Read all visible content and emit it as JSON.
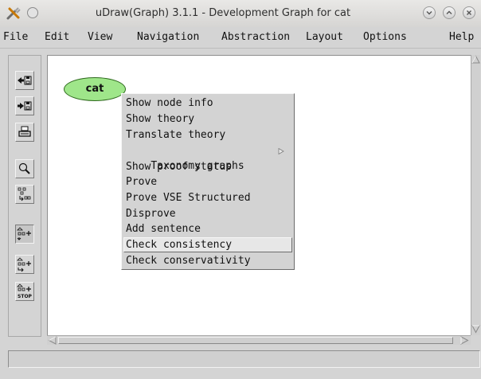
{
  "window": {
    "title": "uDraw(Graph) 3.1.1 - Development Graph for cat",
    "buttons": [
      "shade",
      "minimize",
      "maximize",
      "close"
    ]
  },
  "menubar": {
    "items": [
      {
        "label": "File"
      },
      {
        "label": "Edit"
      },
      {
        "label": "View"
      },
      {
        "label": "Navigation"
      },
      {
        "label": "Abstraction"
      },
      {
        "label": "Layout"
      },
      {
        "label": "Options"
      },
      {
        "label": "Help"
      }
    ]
  },
  "toolbar": {
    "buttons": [
      {
        "icon": "load-graph-icon"
      },
      {
        "icon": "save-graph-icon"
      },
      {
        "icon": "print-icon"
      },
      {
        "icon": "zoom-icon"
      },
      {
        "icon": "scale-graph-icon"
      },
      {
        "icon": "layout-horizontal-icon",
        "pressed": true
      },
      {
        "icon": "layout-vertical-icon"
      },
      {
        "icon": "stop-layout-icon",
        "text": "STOP"
      }
    ]
  },
  "graph": {
    "nodes": [
      {
        "label": "cat",
        "color": "#9fe68a"
      }
    ]
  },
  "context_menu": {
    "items": [
      {
        "label": "Show node info"
      },
      {
        "label": "Show theory"
      },
      {
        "label": "Translate theory"
      },
      {
        "label": "Taxonomy graphs",
        "submenu": true
      },
      {
        "label": "Show proof status"
      },
      {
        "label": "Prove"
      },
      {
        "label": "Prove VSE Structured"
      },
      {
        "label": "Disprove"
      },
      {
        "label": "Add sentence"
      },
      {
        "label": "Check consistency",
        "active": true
      },
      {
        "label": "Check conservativity"
      }
    ]
  },
  "statusbar": {
    "text": ""
  }
}
